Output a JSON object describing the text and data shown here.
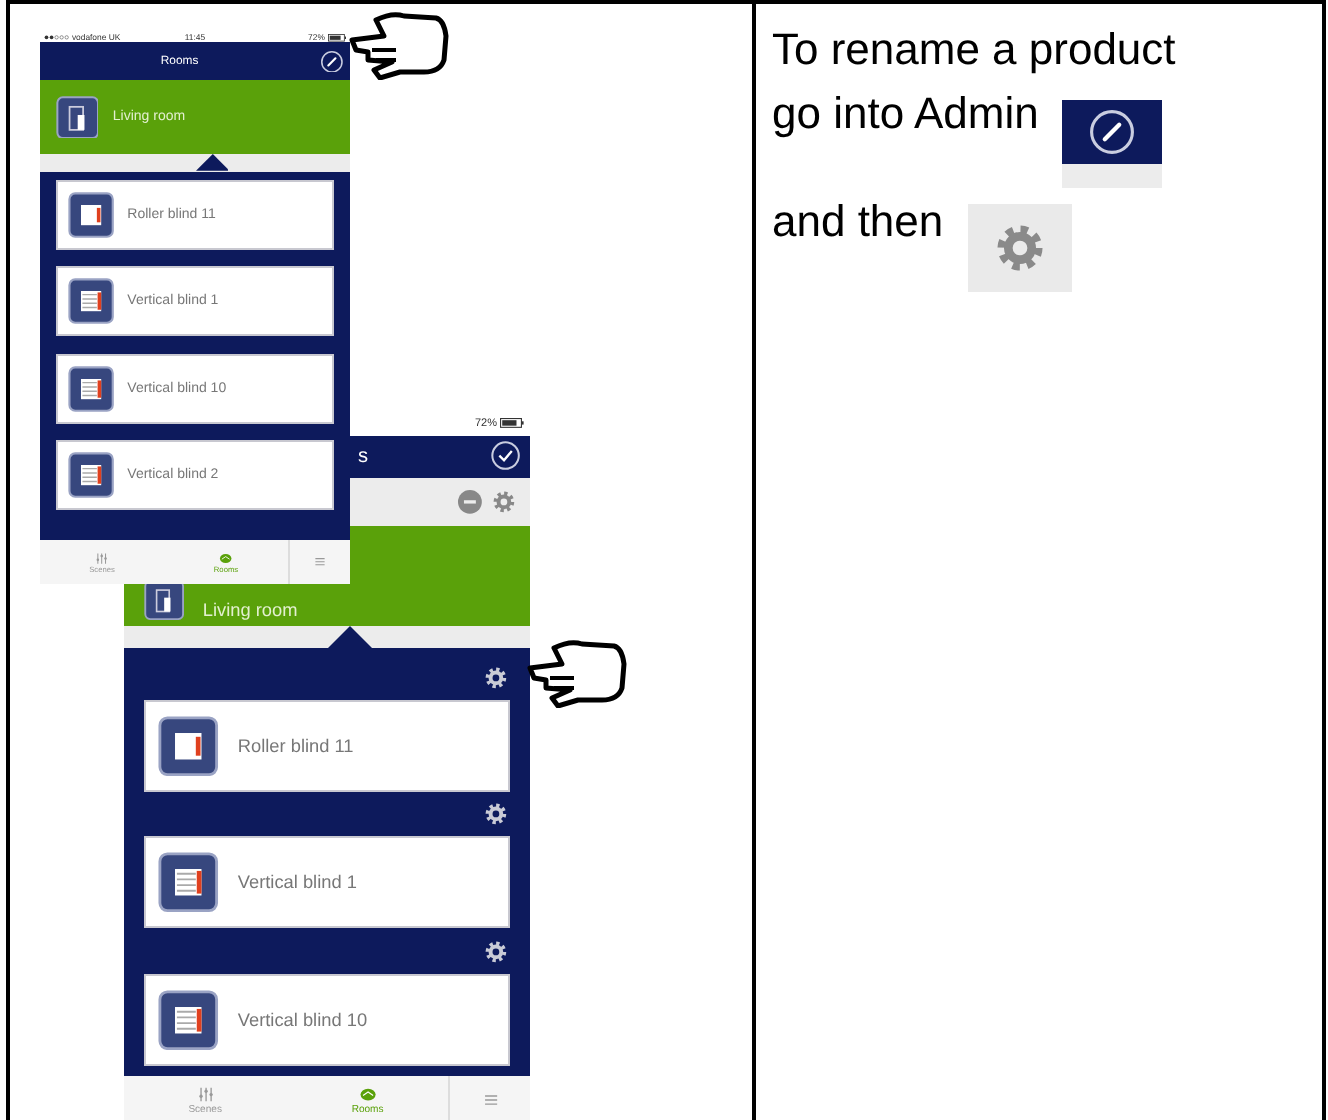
{
  "phones": [
    {
      "status": {
        "carrier": "vodafone UK",
        "time": "11:45",
        "battery": "72%"
      },
      "header": {
        "title": "Rooms",
        "kind": "edit"
      },
      "toolbar": false,
      "room": {
        "name": "Living room"
      },
      "product_settings": false,
      "products": [
        {
          "name": "Roller blind 11",
          "kind": "roller"
        },
        {
          "name": "Vertical blind 1",
          "kind": "vertical"
        },
        {
          "name": "Vertical blind 10",
          "kind": "vertical"
        },
        {
          "name": "Vertical blind 2",
          "kind": "vertical"
        }
      ],
      "tabs": [
        {
          "label": "Scenes",
          "kind": "scenes",
          "selected": false
        },
        {
          "label": "Rooms",
          "kind": "rooms",
          "selected": true
        },
        {
          "kind": "menu",
          "selected": false
        }
      ]
    },
    {
      "status": {
        "battery": "72%"
      },
      "header": {
        "title": "s",
        "kind": "confirm"
      },
      "toolbar": true,
      "room": {
        "name": "Living room"
      },
      "product_settings": true,
      "products": [
        {
          "name": "Roller blind 11",
          "kind": "roller"
        },
        {
          "name": "Vertical blind 1",
          "kind": "vertical"
        },
        {
          "name": "Vertical blind 10",
          "kind": "vertical"
        }
      ],
      "tabs": [
        {
          "label": "Scenes",
          "kind": "scenes",
          "selected": false
        },
        {
          "label": "Rooms",
          "kind": "rooms",
          "selected": true
        },
        {
          "kind": "menu",
          "selected": false
        }
      ]
    }
  ],
  "instructions": {
    "lines": [
      "To rename a product",
      "go into Admin",
      "and then"
    ]
  }
}
